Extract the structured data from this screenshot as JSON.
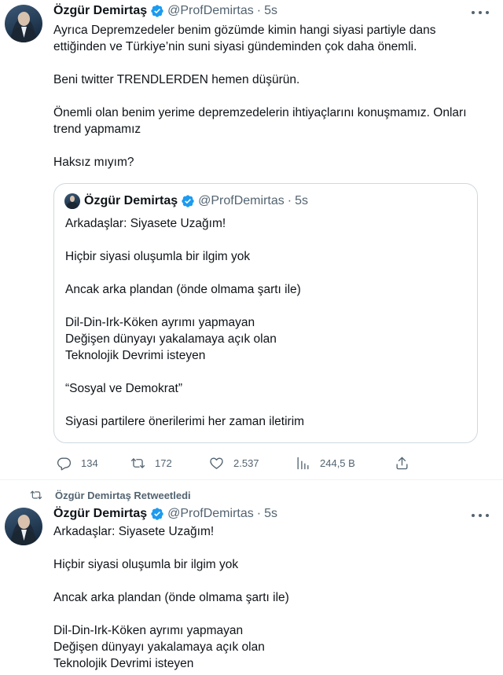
{
  "colors": {
    "accent": "#1d9bf0",
    "text": "#0f1419",
    "muted": "#536471",
    "border": "#cfd9de"
  },
  "tweet1": {
    "author_name": "Özgür Demirtaş",
    "handle": "@ProfDemirtas",
    "separator": "·",
    "time": "5s",
    "text": "Ayrıca Depremzedeler benim gözümde kimin hangi siyasi partiyle dans ettiğinden ve Türkiye’nin suni siyasi gündeminden çok daha önemli.\n\nBeni twitter TRENDLERDEN hemen düşürün.\n\nÖnemli olan benim yerime depremzedelerin ihtiyaçlarını konuşmamız. Onları trend yapmamız\n\nHaksız mıyım?",
    "quote": {
      "author_name": "Özgür Demirtaş",
      "handle": "@ProfDemirtas",
      "separator": "·",
      "time": "5s",
      "text": "Arkadaşlar: Siyasete Uzağım!\n\nHiçbir siyasi oluşumla bir ilgim yok\n\nAncak arka plandan (önde olmama şartı ile)\n\nDil-Din-Irk-Köken ayrımı yapmayan\nDeğişen dünyayı yakalamaya açık olan\nTeknolojik Devrimi isteyen\n\n“Sosyal ve Demokrat”\n\nSiyasi partilere önerilerimi her zaman iletirim"
    },
    "actions": {
      "replies": "134",
      "retweets": "172",
      "likes": "2.537",
      "views": "244,5 B"
    }
  },
  "retweet_label": "Özgür Demirtaş Retweetledi",
  "tweet2": {
    "author_name": "Özgür Demirtaş",
    "handle": "@ProfDemirtas",
    "separator": "·",
    "time": "5s",
    "text": "Arkadaşlar: Siyasete Uzağım!\n\nHiçbir siyasi oluşumla bir ilgim yok\n\nAncak arka plandan (önde olmama şartı ile)\n\nDil-Din-Irk-Köken ayrımı yapmayan\nDeğişen dünyayı yakalamaya açık olan\nTeknolojik Devrimi isteyen"
  },
  "icons": {
    "verified": "verified-badge-icon",
    "more": "more-options-icon",
    "reply": "reply-icon",
    "retweet": "retweet-icon",
    "like": "like-icon",
    "views": "views-icon",
    "share": "share-icon"
  }
}
